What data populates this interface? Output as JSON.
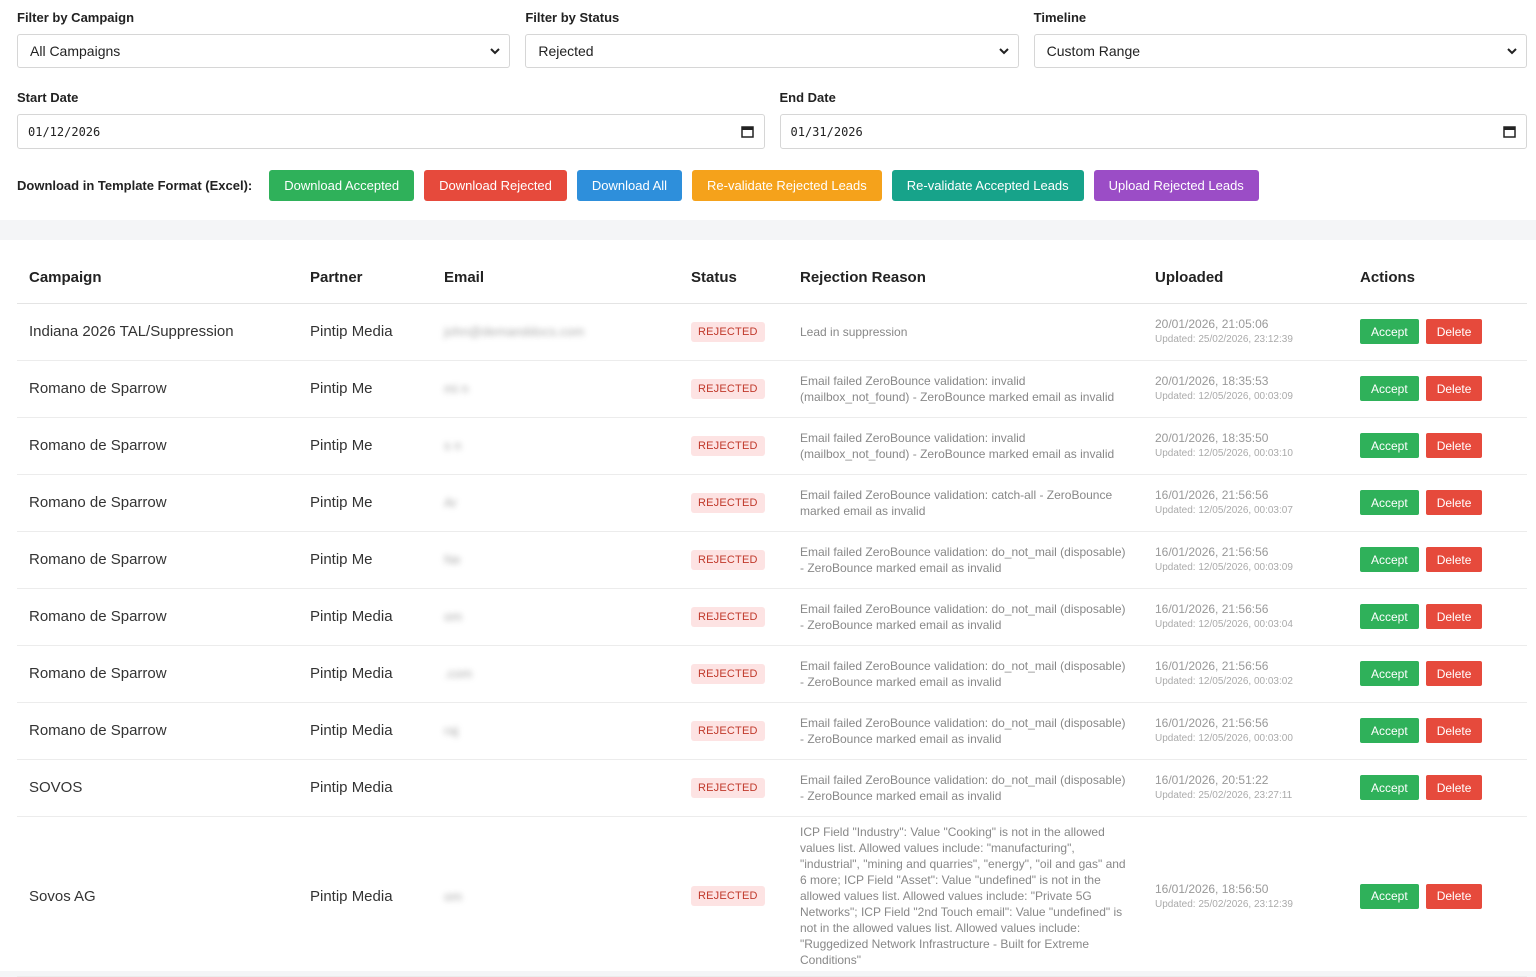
{
  "filters": {
    "campaign_label": "Filter by Campaign",
    "campaign_value": "All Campaigns",
    "status_label": "Filter by Status",
    "status_value": "Rejected",
    "timeline_label": "Timeline",
    "timeline_value": "Custom Range",
    "start_label": "Start Date",
    "start_value": "01/12/2026",
    "end_label": "End Date",
    "end_value": "01/31/2026"
  },
  "downloads": {
    "label": "Download in Template Format (Excel):",
    "accepted": "Download Accepted",
    "rejected": "Download Rejected",
    "all": "Download All",
    "revalidate_rejected": "Re-validate Rejected Leads",
    "revalidate_accepted": "Re-validate Accepted Leads",
    "upload_rejected": "Upload Rejected Leads"
  },
  "table": {
    "headers": [
      "Campaign",
      "Partner",
      "Email",
      "Status",
      "Rejection Reason",
      "Uploaded",
      "Actions"
    ],
    "accept_label": "Accept",
    "delete_label": "Delete",
    "rows": [
      {
        "campaign": "Indiana 2026 TAL/Suppression",
        "partner": "Pintip Media",
        "email": "john@demanddocs.com",
        "status": "REJECTED",
        "reason": "Lead in suppression",
        "uploaded": "20/01/2026, 21:05:06",
        "updated": "Updated: 25/02/2026, 23:12:39"
      },
      {
        "campaign": "Romano de Sparrow",
        "partner": "Pintip Me",
        "email": "mi                          n",
        "status": "REJECTED",
        "reason": "Email failed ZeroBounce validation: invalid (mailbox_not_found) - ZeroBounce marked email as invalid",
        "uploaded": "20/01/2026, 18:35:53",
        "updated": "Updated: 12/05/2026, 00:03:09"
      },
      {
        "campaign": "Romano de Sparrow",
        "partner": "Pintip Me",
        "email": "s                    n",
        "status": "REJECTED",
        "reason": "Email failed ZeroBounce validation: invalid (mailbox_not_found) - ZeroBounce marked email as invalid",
        "uploaded": "20/01/2026, 18:35:50",
        "updated": "Updated: 12/05/2026, 00:03:10"
      },
      {
        "campaign": "Romano de Sparrow",
        "partner": "Pintip Me",
        "email": "Ar",
        "status": "REJECTED",
        "reason": "Email failed ZeroBounce validation: catch-all - ZeroBounce marked email as invalid",
        "uploaded": "16/01/2026, 21:56:56",
        "updated": "Updated: 12/05/2026, 00:03:07"
      },
      {
        "campaign": "Romano de Sparrow",
        "partner": "Pintip Me",
        "email": "Ne",
        "status": "REJECTED",
        "reason": "Email failed ZeroBounce validation: do_not_mail (disposable) - ZeroBounce marked email as invalid",
        "uploaded": "16/01/2026, 21:56:56",
        "updated": "Updated: 12/05/2026, 00:03:09"
      },
      {
        "campaign": "Romano de Sparrow",
        "partner": "Pintip Media",
        "email": "             om",
        "status": "REJECTED",
        "reason": "Email failed ZeroBounce validation: do_not_mail (disposable) - ZeroBounce marked email as invalid",
        "uploaded": "16/01/2026, 21:56:56",
        "updated": "Updated: 12/05/2026, 00:03:04"
      },
      {
        "campaign": "Romano de Sparrow",
        "partner": "Pintip Media",
        "email": "               .com",
        "status": "REJECTED",
        "reason": "Email failed ZeroBounce validation: do_not_mail (disposable) - ZeroBounce marked email as invalid",
        "uploaded": "16/01/2026, 21:56:56",
        "updated": "Updated: 12/05/2026, 00:03:02"
      },
      {
        "campaign": "Romano de Sparrow",
        "partner": "Pintip Media",
        "email": "raj",
        "status": "REJECTED",
        "reason": "Email failed ZeroBounce validation: do_not_mail (disposable) - ZeroBounce marked email as invalid",
        "uploaded": "16/01/2026, 21:56:56",
        "updated": "Updated: 12/05/2026, 00:03:00"
      },
      {
        "campaign": "SOVOS",
        "partner": "Pintip Media",
        "email": "              ",
        "status": "REJECTED",
        "reason": "Email failed ZeroBounce validation: do_not_mail (disposable) - ZeroBounce marked email as invalid",
        "uploaded": "16/01/2026, 20:51:22",
        "updated": "Updated: 25/02/2026, 23:27:11"
      },
      {
        "campaign": "Sovos AG",
        "partner": "Pintip Media",
        "email": "               om",
        "status": "REJECTED",
        "reason": "ICP Field \"Industry\": Value \"Cooking\" is not in the allowed values list. Allowed values include: \"manufacturing\", \"industrial\", \"mining and quarries\", \"energy\", \"oil and gas\" and 6 more; ICP Field \"Asset\": Value \"undefined\" is not in the allowed values list. Allowed values include: \"Private 5G Networks\"; ICP Field \"2nd Touch email\": Value \"undefined\" is not in the allowed values list. Allowed values include: \"Ruggedized Network Infrastructure - Built for Extreme Conditions\"",
        "uploaded": "16/01/2026, 18:56:50",
        "updated": "Updated: 25/02/2026, 23:12:39"
      }
    ]
  }
}
